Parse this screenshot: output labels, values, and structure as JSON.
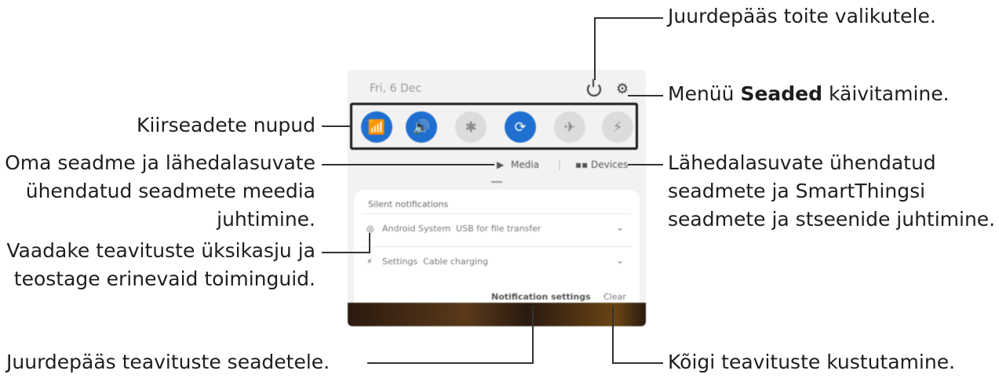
{
  "phone": {
    "date": "Fri, 6 Dec",
    "media_label": "Media",
    "devices_label": "Devices",
    "notifications_header": "Silent notifications",
    "notifications": [
      {
        "app": "Android System",
        "text": "USB for file transfer"
      },
      {
        "app": "Settings",
        "text": "Cable charging"
      }
    ],
    "notification_settings_label": "Notification settings",
    "clear_label": "Clear",
    "quick_settings": [
      {
        "name": "wifi",
        "on": true,
        "glyph": "📶"
      },
      {
        "name": "sound",
        "on": true,
        "glyph": "🔊"
      },
      {
        "name": "bluetooth",
        "on": false,
        "glyph": "✱"
      },
      {
        "name": "auto-rotate",
        "on": true,
        "glyph": "⟳"
      },
      {
        "name": "airplane",
        "on": false,
        "glyph": "✈"
      },
      {
        "name": "flashlight",
        "on": false,
        "glyph": "⚡"
      }
    ]
  },
  "callouts": {
    "power": "Juurdepääs toite valikutele.",
    "settings_pre": "Menüü ",
    "settings_bold": "Seaded",
    "settings_post": " käivitamine.",
    "quick_buttons": "Kiirseadete nupud",
    "media_line1": "Oma seadme ja lähedalasuvate",
    "media_line2": "ühendatud seadmete meedia",
    "media_line3": "juhtimine.",
    "devices_line1": "Lähedalasuvate ühendatud",
    "devices_line2": "seadmete ja SmartThingsi",
    "devices_line3": "seadmete ja stseenide juhtimine.",
    "details_line1": "Vaadake teavituste üksikasju ja",
    "details_line2": "teostage erinevaid toiminguid.",
    "notif_settings": "Juurdepääs teavituste seadetele.",
    "clear_all": "Kõigi teavituste kustutamine."
  }
}
